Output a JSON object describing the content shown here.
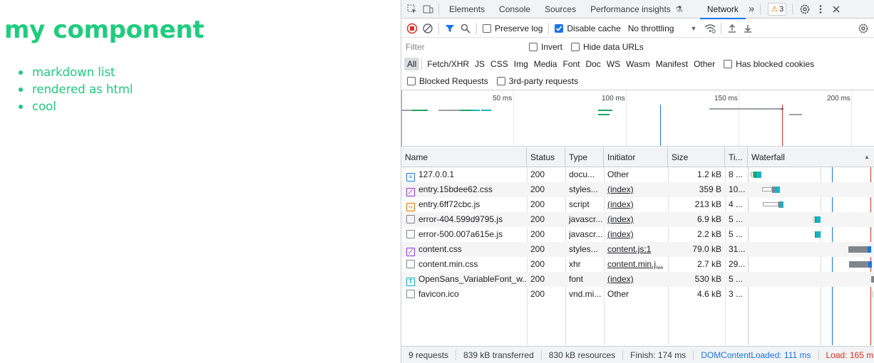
{
  "page": {
    "heading": "my component",
    "list": [
      "markdown list",
      "rendered as html",
      "cool"
    ]
  },
  "devtools": {
    "tabs": [
      "Elements",
      "Console",
      "Sources",
      "Performance insights",
      "Network"
    ],
    "active_tab": "Network",
    "more_tabs_glyph": "»",
    "warnings_count": "3",
    "toolbar": {
      "preserve_log": "Preserve log",
      "disable_cache": "Disable cache",
      "throttling": "No throttling"
    },
    "filter": {
      "placeholder": "Filter",
      "invert": "Invert",
      "hide_data_urls": "Hide data URLs"
    },
    "type_filters": [
      "All",
      "Fetch/XHR",
      "JS",
      "CSS",
      "Img",
      "Media",
      "Font",
      "Doc",
      "WS",
      "Wasm",
      "Manifest",
      "Other"
    ],
    "has_blocked_cookies": "Has blocked cookies",
    "blocked_requests": "Blocked Requests",
    "third_party": "3rd-party requests",
    "overview_labels": [
      "50 ms",
      "100 ms",
      "150 ms",
      "200 ms"
    ],
    "columns": {
      "name": "Name",
      "status": "Status",
      "type": "Type",
      "initiator": "Initiator",
      "size": "Size",
      "time": "Ti...",
      "waterfall": "Waterfall"
    },
    "requests": [
      {
        "name": "127.0.0.1",
        "icon": "doc",
        "status": "200",
        "type": "docu...",
        "initiator": "Other",
        "initiator_link": false,
        "size": "1.2 kB",
        "time": "8 ..."
      },
      {
        "name": "entry.15bdee62.css",
        "icon": "css",
        "status": "200",
        "type": "styles...",
        "initiator": "(index)",
        "initiator_link": true,
        "size": "359 B",
        "time": "10..."
      },
      {
        "name": "entry.6ff72cbc.js",
        "icon": "js",
        "status": "200",
        "type": "script",
        "initiator": "(index)",
        "initiator_link": true,
        "size": "213 kB",
        "time": "4 ..."
      },
      {
        "name": "error-404.599d9795.js",
        "icon": "plain",
        "status": "200",
        "type": "javascr...",
        "initiator": "(index)",
        "initiator_link": true,
        "size": "6.9 kB",
        "time": "5 ..."
      },
      {
        "name": "error-500.007a615e.js",
        "icon": "plain",
        "status": "200",
        "type": "javascr...",
        "initiator": "(index)",
        "initiator_link": true,
        "size": "2.2 kB",
        "time": "5 ..."
      },
      {
        "name": "content.css",
        "icon": "css",
        "status": "200",
        "type": "styles...",
        "initiator": "content.js:1",
        "initiator_link": true,
        "size": "79.0 kB",
        "time": "31..."
      },
      {
        "name": "content.min.css",
        "icon": "plain",
        "status": "200",
        "type": "xhr",
        "initiator": "content.min.j...",
        "initiator_link": true,
        "size": "2.7 kB",
        "time": "29..."
      },
      {
        "name": "OpenSans_VariableFont_w...",
        "icon": "font",
        "status": "200",
        "type": "font",
        "initiator": "(index)",
        "initiator_link": true,
        "size": "530 kB",
        "time": "5 ..."
      },
      {
        "name": "favicon.ico",
        "icon": "plain",
        "status": "200",
        "type": "vnd.mi...",
        "initiator": "Other",
        "initiator_link": false,
        "size": "4.6 kB",
        "time": "3 ..."
      }
    ],
    "status": {
      "requests": "9 requests",
      "transferred": "839 kB transferred",
      "resources": "830 kB resources",
      "finish": "Finish: 174 ms",
      "dom": "DOMContentLoaded: 111 ms",
      "load": "Load: 165 ms"
    },
    "colors": {
      "accent": "#1a73e8",
      "dom_line": "#1a73e8",
      "load_line": "#d93025",
      "heading": "#1fcc7d"
    }
  }
}
